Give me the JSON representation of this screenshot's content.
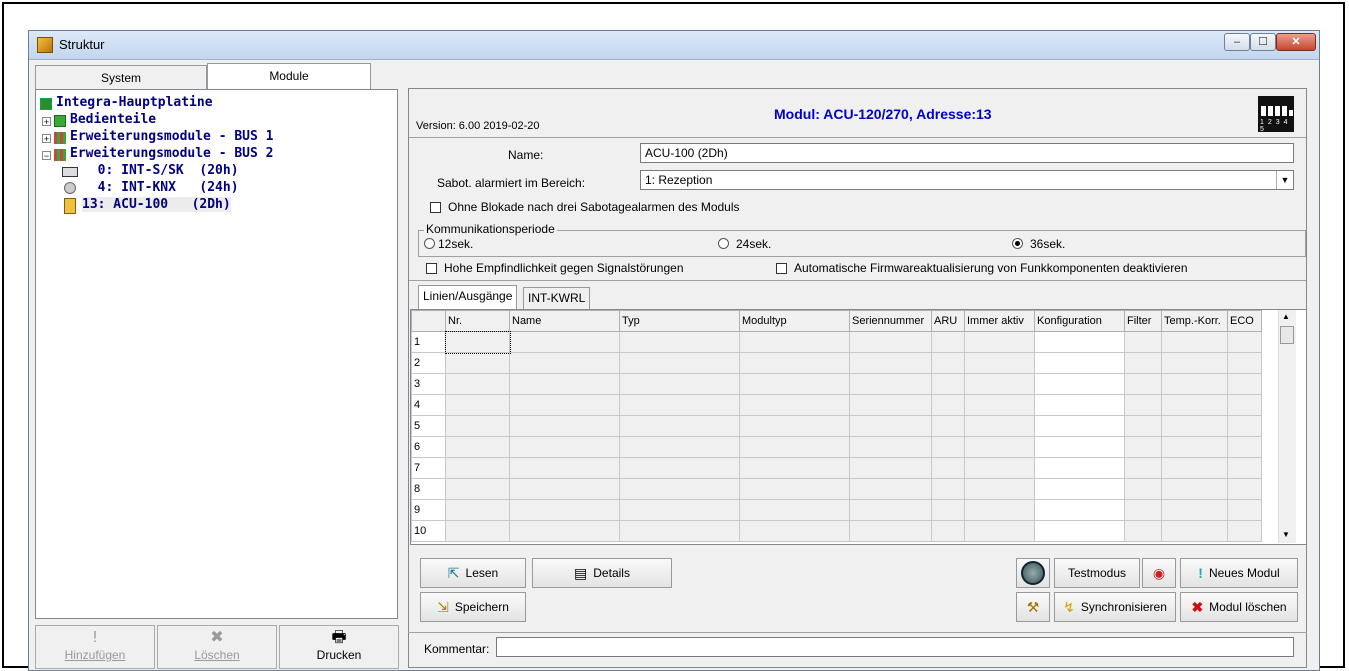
{
  "window": {
    "title": "Struktur"
  },
  "left_tabs": [
    "System",
    "Module"
  ],
  "tree": {
    "root": "Integra-Hauptplatine",
    "items": [
      "Bedienteile",
      "Erweiterungsmodule - BUS 1",
      "Erweiterungsmodule - BUS 2",
      "  0: INT-S/SK  (20h)",
      "  4: INT-KNX   (24h)",
      "13: ACU-100   (2Dh)"
    ]
  },
  "bottom_buttons": {
    "add": "Hinzufügen",
    "delete": "Löschen",
    "print": "Drucken"
  },
  "module": {
    "version": "Version: 6.00 2019-02-20",
    "header": "Modul: ACU-120/270, Adresse:13",
    "dip_labels": [
      "1",
      "2",
      "3",
      "4",
      "5"
    ],
    "name_label": "Name:",
    "name_value": "ACU-100  (2Dh)",
    "sabot_label": "Sabot. alarmiert im Bereich:",
    "sabot_value": "1: Rezeption",
    "no_block_label": "Ohne Blokade nach drei Sabotagealarmen des Moduls",
    "comm_group_label": "Kommunikationsperiode",
    "comm_options": [
      "12sek.",
      "24sek.",
      "36sek."
    ],
    "comm_selected": "36sek.",
    "high_sens_label": "Hohe Empfindlichkeit gegen Signalstörungen",
    "auto_fw_label": "Automatische Firmwareaktualisierung von Funkkomponenten deaktivieren"
  },
  "subtabs": [
    "Linien/Ausgänge",
    "INT-KWRL"
  ],
  "grid": {
    "columns": [
      "Nr.",
      "Name",
      "Typ",
      "Modultyp",
      "Seriennummer",
      "ARU",
      "Immer aktiv",
      "Konfiguration",
      "Filter",
      "Temp.-Korr.",
      "ECO"
    ],
    "rows": [
      "1",
      "2",
      "3",
      "4",
      "5",
      "6",
      "7",
      "8",
      "9",
      "10"
    ]
  },
  "actions": {
    "read": "Lesen",
    "details": "Details",
    "save": "Speichern",
    "testmode": "Testmodus",
    "new_module": "Neues Modul",
    "sync": "Synchronisieren",
    "delete_module": "Modul löschen"
  },
  "comment_label": "Kommentar:",
  "comment_value": ""
}
